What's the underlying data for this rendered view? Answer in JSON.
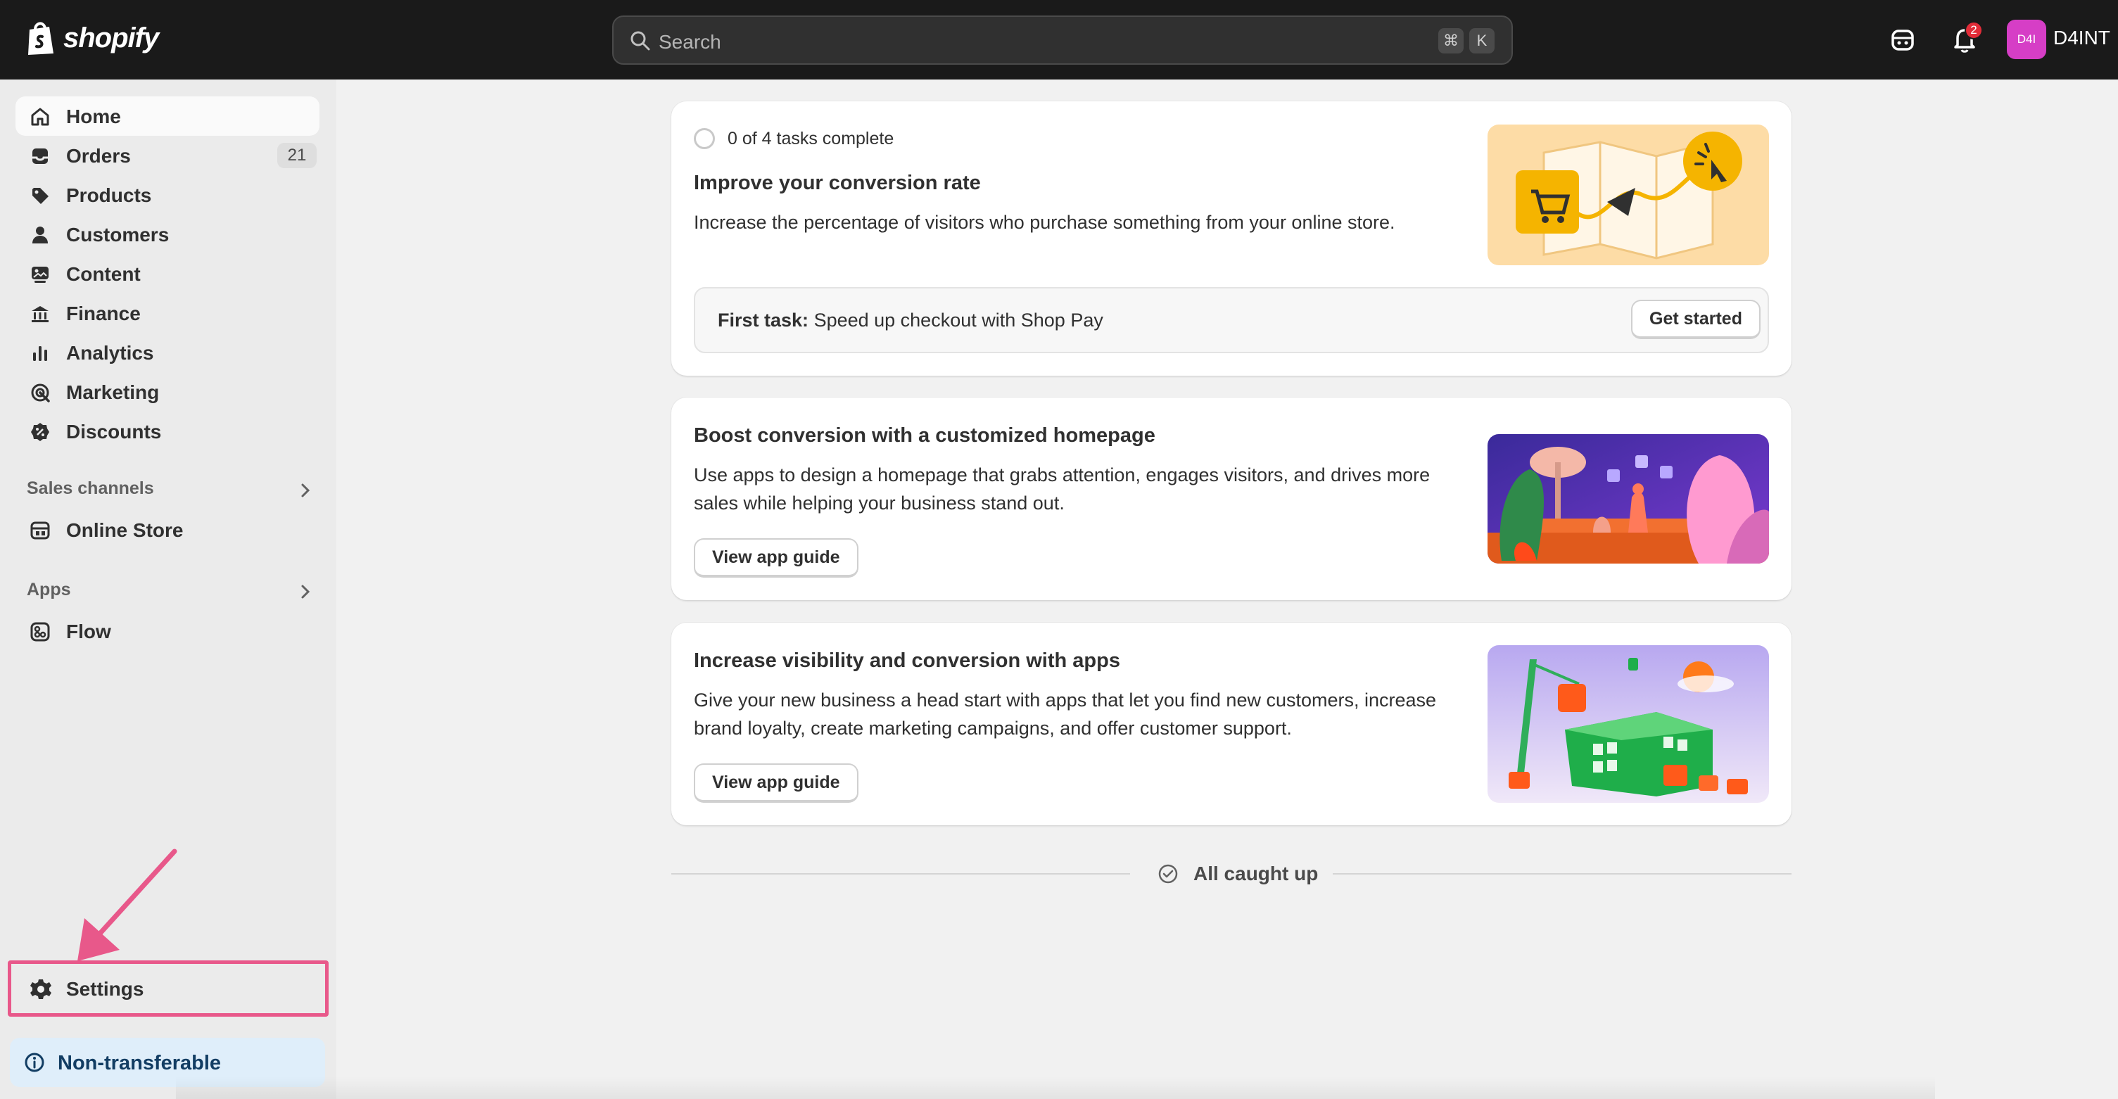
{
  "brand": {
    "name": "shopify"
  },
  "search": {
    "placeholder": "Search",
    "shortcut_mod": "⌘",
    "shortcut_key": "K"
  },
  "topbar": {
    "notification_count": "2",
    "avatar_initials": "D4I",
    "store_name": "D4INT"
  },
  "sidebar": {
    "items": [
      {
        "label": "Home",
        "icon": "home-icon"
      },
      {
        "label": "Orders",
        "icon": "inbox-icon",
        "count": "21"
      },
      {
        "label": "Products",
        "icon": "tag-icon"
      },
      {
        "label": "Customers",
        "icon": "person-icon"
      },
      {
        "label": "Content",
        "icon": "image-icon"
      },
      {
        "label": "Finance",
        "icon": "bank-icon"
      },
      {
        "label": "Analytics",
        "icon": "bar-chart-icon"
      },
      {
        "label": "Marketing",
        "icon": "target-icon"
      },
      {
        "label": "Discounts",
        "icon": "discount-icon"
      }
    ],
    "sales_channels": {
      "title": "Sales channels",
      "items": [
        {
          "label": "Online Store",
          "icon": "storefront-icon"
        }
      ]
    },
    "apps": {
      "title": "Apps",
      "items": [
        {
          "label": "Flow",
          "icon": "flow-icon"
        }
      ]
    },
    "settings": {
      "label": "Settings",
      "icon": "gear-icon"
    },
    "non_transferable": {
      "label": "Non-transferable",
      "icon": "info-icon"
    }
  },
  "cards": [
    {
      "progress": "0 of 4 tasks complete",
      "title": "Improve your conversion rate",
      "description": "Increase the percentage of visitors who purchase something from your online store.",
      "task_prefix": "First task:",
      "task_text": "Speed up checkout with Shop Pay",
      "button": "Get started"
    },
    {
      "title": "Boost conversion with a customized homepage",
      "description": "Use apps to design a homepage that grabs attention, engages visitors, and drives more sales while helping your business stand out.",
      "button": "View app guide"
    },
    {
      "title": "Increase visibility and conversion with apps",
      "description": "Give your new business a head start with apps that let you find new customers, increase brand loyalty, create marketing campaigns, and offer customer support.",
      "button": "View app guide"
    }
  ],
  "footer": {
    "caught_up": "All caught up"
  },
  "colors": {
    "topbar": "#1a1a1a",
    "highlight": "#e8588a",
    "avatar": "#d63ec6",
    "badge": "#e22c38",
    "info_bg": "#dfeefa"
  }
}
